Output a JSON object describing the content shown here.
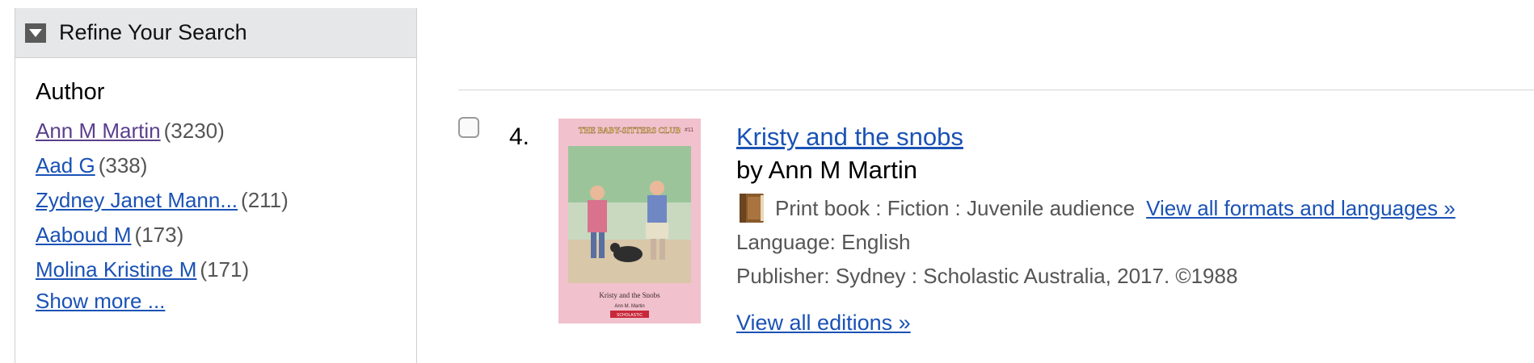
{
  "sidebar": {
    "header": "Refine Your Search",
    "facet_title": "Author",
    "authors": [
      {
        "name": "Ann M Martin",
        "count": "(3230)"
      },
      {
        "name": "Aad G",
        "count": "(338)"
      },
      {
        "name": "Zydney Janet Mann...",
        "count": "(211)"
      },
      {
        "name": "Aaboud M",
        "count": "(173)"
      },
      {
        "name": "Molina Kristine M",
        "count": "(171)"
      }
    ],
    "show_more": "Show more ..."
  },
  "result": {
    "number": "4.",
    "title": "Kristy and the snobs",
    "byline": "by Ann M Martin",
    "format": "Print book : Fiction : Juvenile audience",
    "formats_link": "View all formats and languages »",
    "language": "Language: English",
    "publisher": "Publisher: Sydney : Scholastic Australia, 2017. ©1988",
    "editions_link": "View all editions »",
    "cover": {
      "series": "THE BABY-SITTERS CLUB",
      "number": "#11",
      "title": "Kristy and the Snobs",
      "author": "Ann M. Martin",
      "publisher": "SCHOLASTIC"
    }
  },
  "colors": {
    "link": "#1a52b5",
    "visited_link": "#5b3f8c",
    "header_bg": "#e6e7e9",
    "cover_bg": "#f1c1cd"
  },
  "icons": {
    "toggle": "triangle-down-icon",
    "format": "book-icon"
  }
}
